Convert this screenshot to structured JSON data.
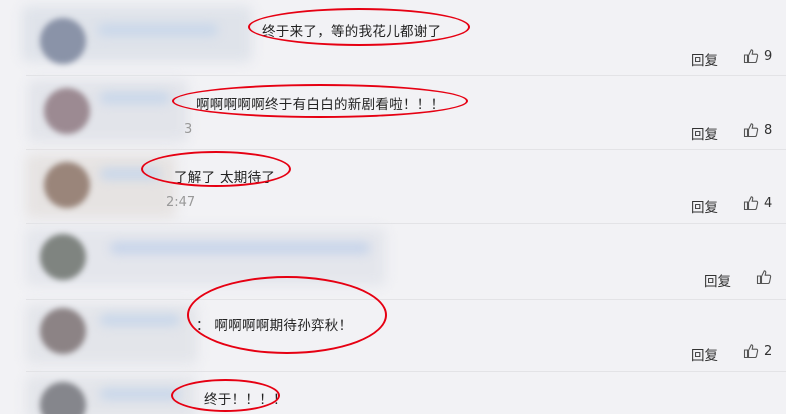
{
  "accent": "#e60012",
  "icons": {
    "like": "thumbs-up-icon"
  },
  "comments": [
    {
      "text": "终于来了，等的我花儿都谢了",
      "time": "",
      "reply": "回复",
      "likes": "9"
    },
    {
      "text": "啊啊啊啊啊终于有白白的新剧看啦！！！",
      "time": "3",
      "reply": "回复",
      "likes": "8"
    },
    {
      "text": "了解了 太期待了",
      "time": "2:47",
      "reply": "回复",
      "likes": "4"
    },
    {
      "text": "",
      "time": "",
      "reply": "回复",
      "likes": ""
    },
    {
      "text": "：  啊啊啊啊期待孙弈秋！",
      "time": "",
      "reply": "回复",
      "likes": "2"
    },
    {
      "text": "终于！！！！",
      "time": "",
      "reply": "",
      "likes": ""
    }
  ]
}
